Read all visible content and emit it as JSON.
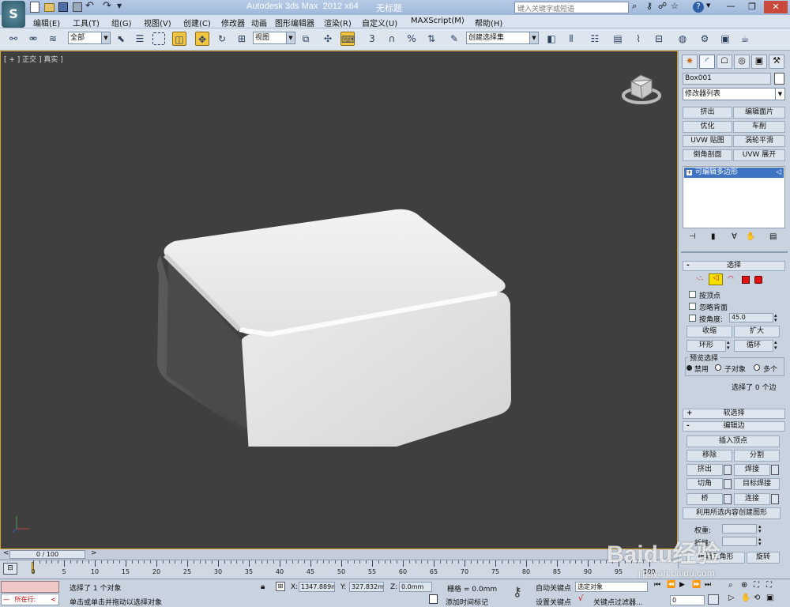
{
  "window": {
    "app_title": "Autodesk 3ds Max  2012 x64",
    "doc_title": "无标题",
    "search_placeholder": "键入关键字或短语"
  },
  "menu": [
    "编辑(E)",
    "工具(T)",
    "组(G)",
    "视图(V)",
    "创建(C)",
    "修改器",
    "动画",
    "图形编辑器",
    "渲染(R)",
    "自定义(U)",
    "MAXScript(M)",
    "帮助(H)"
  ],
  "toolbar": {
    "selection_filter": "全部",
    "ref_coord": "视图",
    "named_selection": "创建选择集",
    "snap_3": "3",
    "percent": "%"
  },
  "viewport": {
    "label": "[ + ] 正交 ] 真实 ]",
    "object_color": "#e6e6e6",
    "bg_color": "#3f3f3f"
  },
  "command_panel": {
    "object_name": "Box001",
    "modifier_list": "修改器列表",
    "mod_buttons": [
      [
        "挤出",
        "编辑面片"
      ],
      [
        "优化",
        "车削"
      ],
      [
        "UVW 贴图",
        "涡轮平滑"
      ],
      [
        "倒角剖面",
        "UVW 展开"
      ]
    ],
    "stack_item": "可编辑多边形",
    "selection": {
      "header": "选择",
      "by_vertex": "按顶点",
      "ignore_backfacing": "忽略背面",
      "by_angle": "按角度:",
      "angle_value": "45.0",
      "shrink": "收缩",
      "grow": "扩大",
      "ring": "环形",
      "loop": "循环",
      "preview_label": "预览选择",
      "preview_options": [
        "禁用",
        "子对象",
        "多个"
      ],
      "selected_info": "选择了 0 个边"
    },
    "soft_selection": "软选择",
    "edit_edges": {
      "header": "编辑边",
      "insert_vertex": "插入顶点",
      "remove": "移除",
      "split": "分割",
      "extrude": "挤出",
      "weld": "焊接",
      "chamfer": "切角",
      "target_weld": "目标焊接",
      "bridge": "桥",
      "connect": "连接",
      "create_shape": "利用所选内容创建图形",
      "weight": "权重:",
      "crease": "折缝:",
      "edit_tri": "编辑三角形",
      "turn": "旋转"
    }
  },
  "timeline": {
    "frame": "0 / 100",
    "ticks": [
      "0",
      "5",
      "10",
      "15",
      "20",
      "25",
      "30",
      "35",
      "40",
      "45",
      "50",
      "55",
      "60",
      "65",
      "70",
      "75",
      "80",
      "85",
      "90",
      "95",
      "100"
    ]
  },
  "status": {
    "maxscript_label": "所在行:",
    "selected": "选择了 1 个对象",
    "prompt": "单击或单击并拖动以选择对象",
    "x_label": "X:",
    "x_value": "1347.889m",
    "y_label": "Y:",
    "y_value": "327.832mm",
    "z_label": "Z:",
    "z_value": "0.0mm",
    "grid": "栅格 = 0.0mm",
    "add_time_tag": "添加时间标记",
    "auto_key": "自动关键点",
    "set_key": "设置关键点",
    "key_mode": "选定对象",
    "key_filters": "关键点过滤器...",
    "frame_field": "0"
  },
  "watermark": {
    "brand": "Baidu经验",
    "url": "jingyan.baidu.com"
  }
}
